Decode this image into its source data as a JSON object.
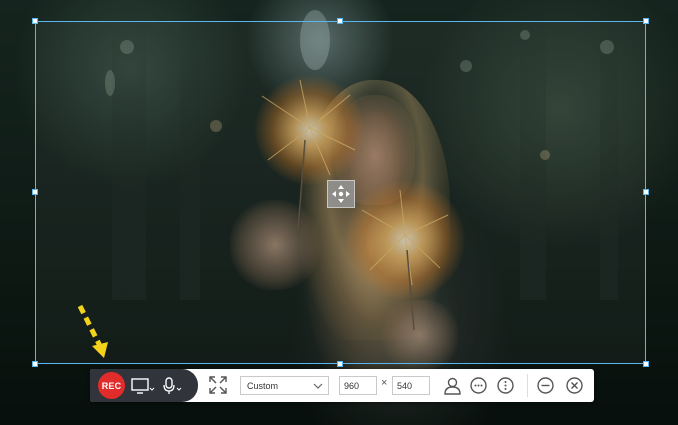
{
  "toolbar": {
    "rec_label": "REC",
    "size_preset": "Custom",
    "width_value": "960",
    "height_value": "540",
    "times_symbol": "×"
  },
  "icons": {
    "screen": "monitor-icon",
    "mic": "microphone-icon",
    "fullscreen": "expand-icon",
    "webcam": "user-icon",
    "chat": "chat-icon",
    "more": "more-vertical-icon",
    "minimize": "minus-circle-icon",
    "close": "close-circle-icon",
    "move": "move-arrows-icon"
  },
  "colors": {
    "selection_border": "#59b6f0",
    "rec_red": "#e12c2c",
    "rec_panel": "#31343a",
    "hint_arrow": "#f2d21a"
  }
}
